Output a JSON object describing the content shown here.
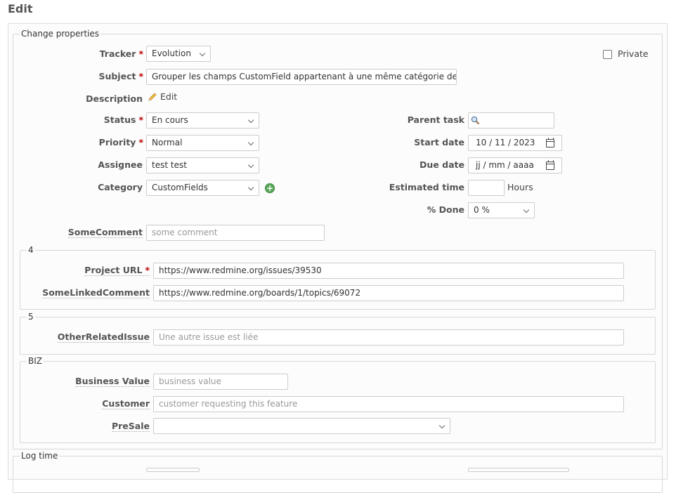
{
  "page": {
    "title": "Edit"
  },
  "properties": {
    "legend": "Change properties",
    "tracker": {
      "label": "Tracker",
      "required": "*",
      "value": "Evolution"
    },
    "private": {
      "label": "Private"
    },
    "subject": {
      "label": "Subject",
      "required": "*",
      "value": "Grouper les champs CustomField appartenant à une même catégorie de"
    },
    "description": {
      "label": "Description",
      "edit_label": "Edit"
    },
    "status": {
      "label": "Status",
      "required": "*",
      "value": "En cours"
    },
    "priority": {
      "label": "Priority",
      "required": "*",
      "value": "Normal"
    },
    "assignee": {
      "label": "Assignee",
      "value": "test test"
    },
    "category": {
      "label": "Category",
      "value": "CustomFields"
    },
    "parent_task": {
      "label": "Parent task",
      "value": ""
    },
    "start_date": {
      "label": "Start date",
      "value": "10 / 11 / 2023"
    },
    "due_date": {
      "label": "Due date",
      "value": "jj / mm / aaaa"
    },
    "estimated_time": {
      "label": "Estimated time",
      "value": "",
      "unit": "Hours"
    },
    "done": {
      "label": "% Done",
      "value": "0 %"
    },
    "some_comment": {
      "label": "SomeComment",
      "placeholder": "some comment"
    }
  },
  "group4": {
    "legend": "4",
    "project_url": {
      "label": "Project URL",
      "required": "*",
      "value": "https://www.redmine.org/issues/39530"
    },
    "linked_comment": {
      "label": "SomeLinkedComment",
      "value": "https://www.redmine.org/boards/1/topics/69072"
    }
  },
  "group5": {
    "legend": "5",
    "other_issue": {
      "label": "OtherRelatedIssue",
      "placeholder": "Une autre issue est liée"
    }
  },
  "biz": {
    "legend": "BIZ",
    "business_value": {
      "label": "Business Value",
      "placeholder": "business value"
    },
    "customer": {
      "label": "Customer",
      "placeholder": "customer requesting this feature"
    },
    "presale": {
      "label": "PreSale",
      "value": ""
    }
  },
  "log_time": {
    "legend": "Log time"
  },
  "colors": {
    "required": "#bb0000",
    "link": "#116699",
    "add": "#5ba85b"
  }
}
